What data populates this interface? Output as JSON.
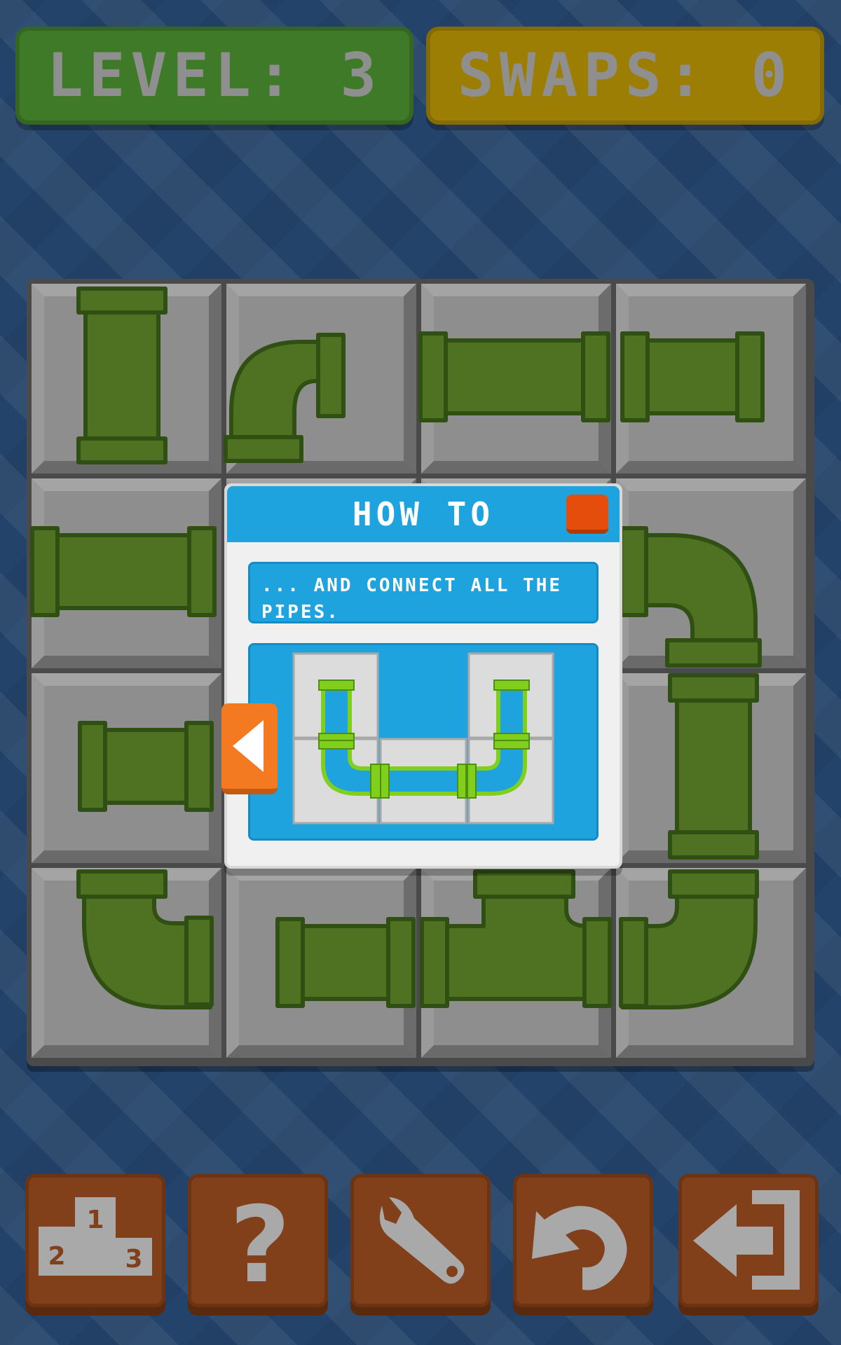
{
  "hud": {
    "level_text": "LEVEL: 3",
    "swaps_text": "SWAPS: 0"
  },
  "board": {
    "rows": 4,
    "cols": 4,
    "tiles": [
      [
        "straight-vertical",
        "elbow-left-down",
        "straight-horizontal",
        "straight-horizontal"
      ],
      [
        "straight-horizontal",
        "how-to-dialog",
        "how-to-dialog",
        "elbow-left-down"
      ],
      [
        "straight-horizontal",
        "how-to-dialog",
        "how-to-dialog",
        "straight-vertical"
      ],
      [
        "elbow-up-right",
        "straight-horizontal",
        "tee-up-left-right",
        "elbow-up-left"
      ]
    ]
  },
  "dialog": {
    "title": "HOW TO",
    "text": "... AND CONNECT ALL THE PIPES.",
    "close_icon": "close-icon",
    "prev_icon": "arrow-left-icon"
  },
  "colors": {
    "background": "#24436a",
    "pipe": "#4e7221",
    "pipe_dark": "#2f4f13",
    "level_box": "#3f7a28",
    "swaps_box": "#9d7e05",
    "dialog_accent": "#1fa3df",
    "toolbar_button": "#82401a"
  },
  "toolbar": [
    {
      "icon": "podium-icon",
      "label_1": "1",
      "label_2": "2",
      "label_3": "3"
    },
    {
      "icon": "help-icon",
      "glyph": "?"
    },
    {
      "icon": "wrench-icon"
    },
    {
      "icon": "undo-icon"
    },
    {
      "icon": "exit-icon"
    }
  ]
}
